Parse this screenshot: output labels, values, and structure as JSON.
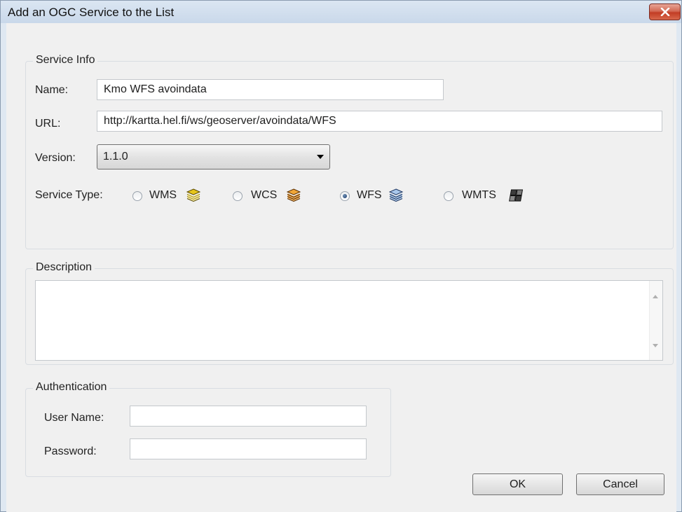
{
  "window": {
    "title": "Add an OGC Service to the List",
    "close_glyph": "✕",
    "close_icon": "close-icon"
  },
  "service_info": {
    "legend": "Service Info",
    "name_label": "Name:",
    "name_value": "Kmo WFS avoindata",
    "url_label": "URL:",
    "url_value": "http://kartta.hel.fi/ws/geoserver/avoindata/WFS",
    "version_label": "Version:",
    "version_value": "1.1.0",
    "service_type_label": "Service Type:",
    "service_types": [
      {
        "label": "WMS",
        "checked": false,
        "icon": "wms-layers-icon",
        "color": "#e6c51c"
      },
      {
        "label": "WCS",
        "checked": false,
        "icon": "wcs-layers-icon",
        "color": "#e8901a"
      },
      {
        "label": "WFS",
        "checked": true,
        "icon": "wfs-layers-icon",
        "color": "#6f9fd6"
      },
      {
        "label": "WMTS",
        "checked": false,
        "icon": "wmts-tiles-icon",
        "color": "#3c3c3c"
      }
    ]
  },
  "description": {
    "legend": "Description",
    "value": ""
  },
  "authentication": {
    "legend": "Authentication",
    "username_label": "User Name:",
    "username_value": "",
    "password_label": "Password:",
    "password_value": ""
  },
  "buttons": {
    "ok_label": "OK",
    "cancel_label": "Cancel"
  }
}
